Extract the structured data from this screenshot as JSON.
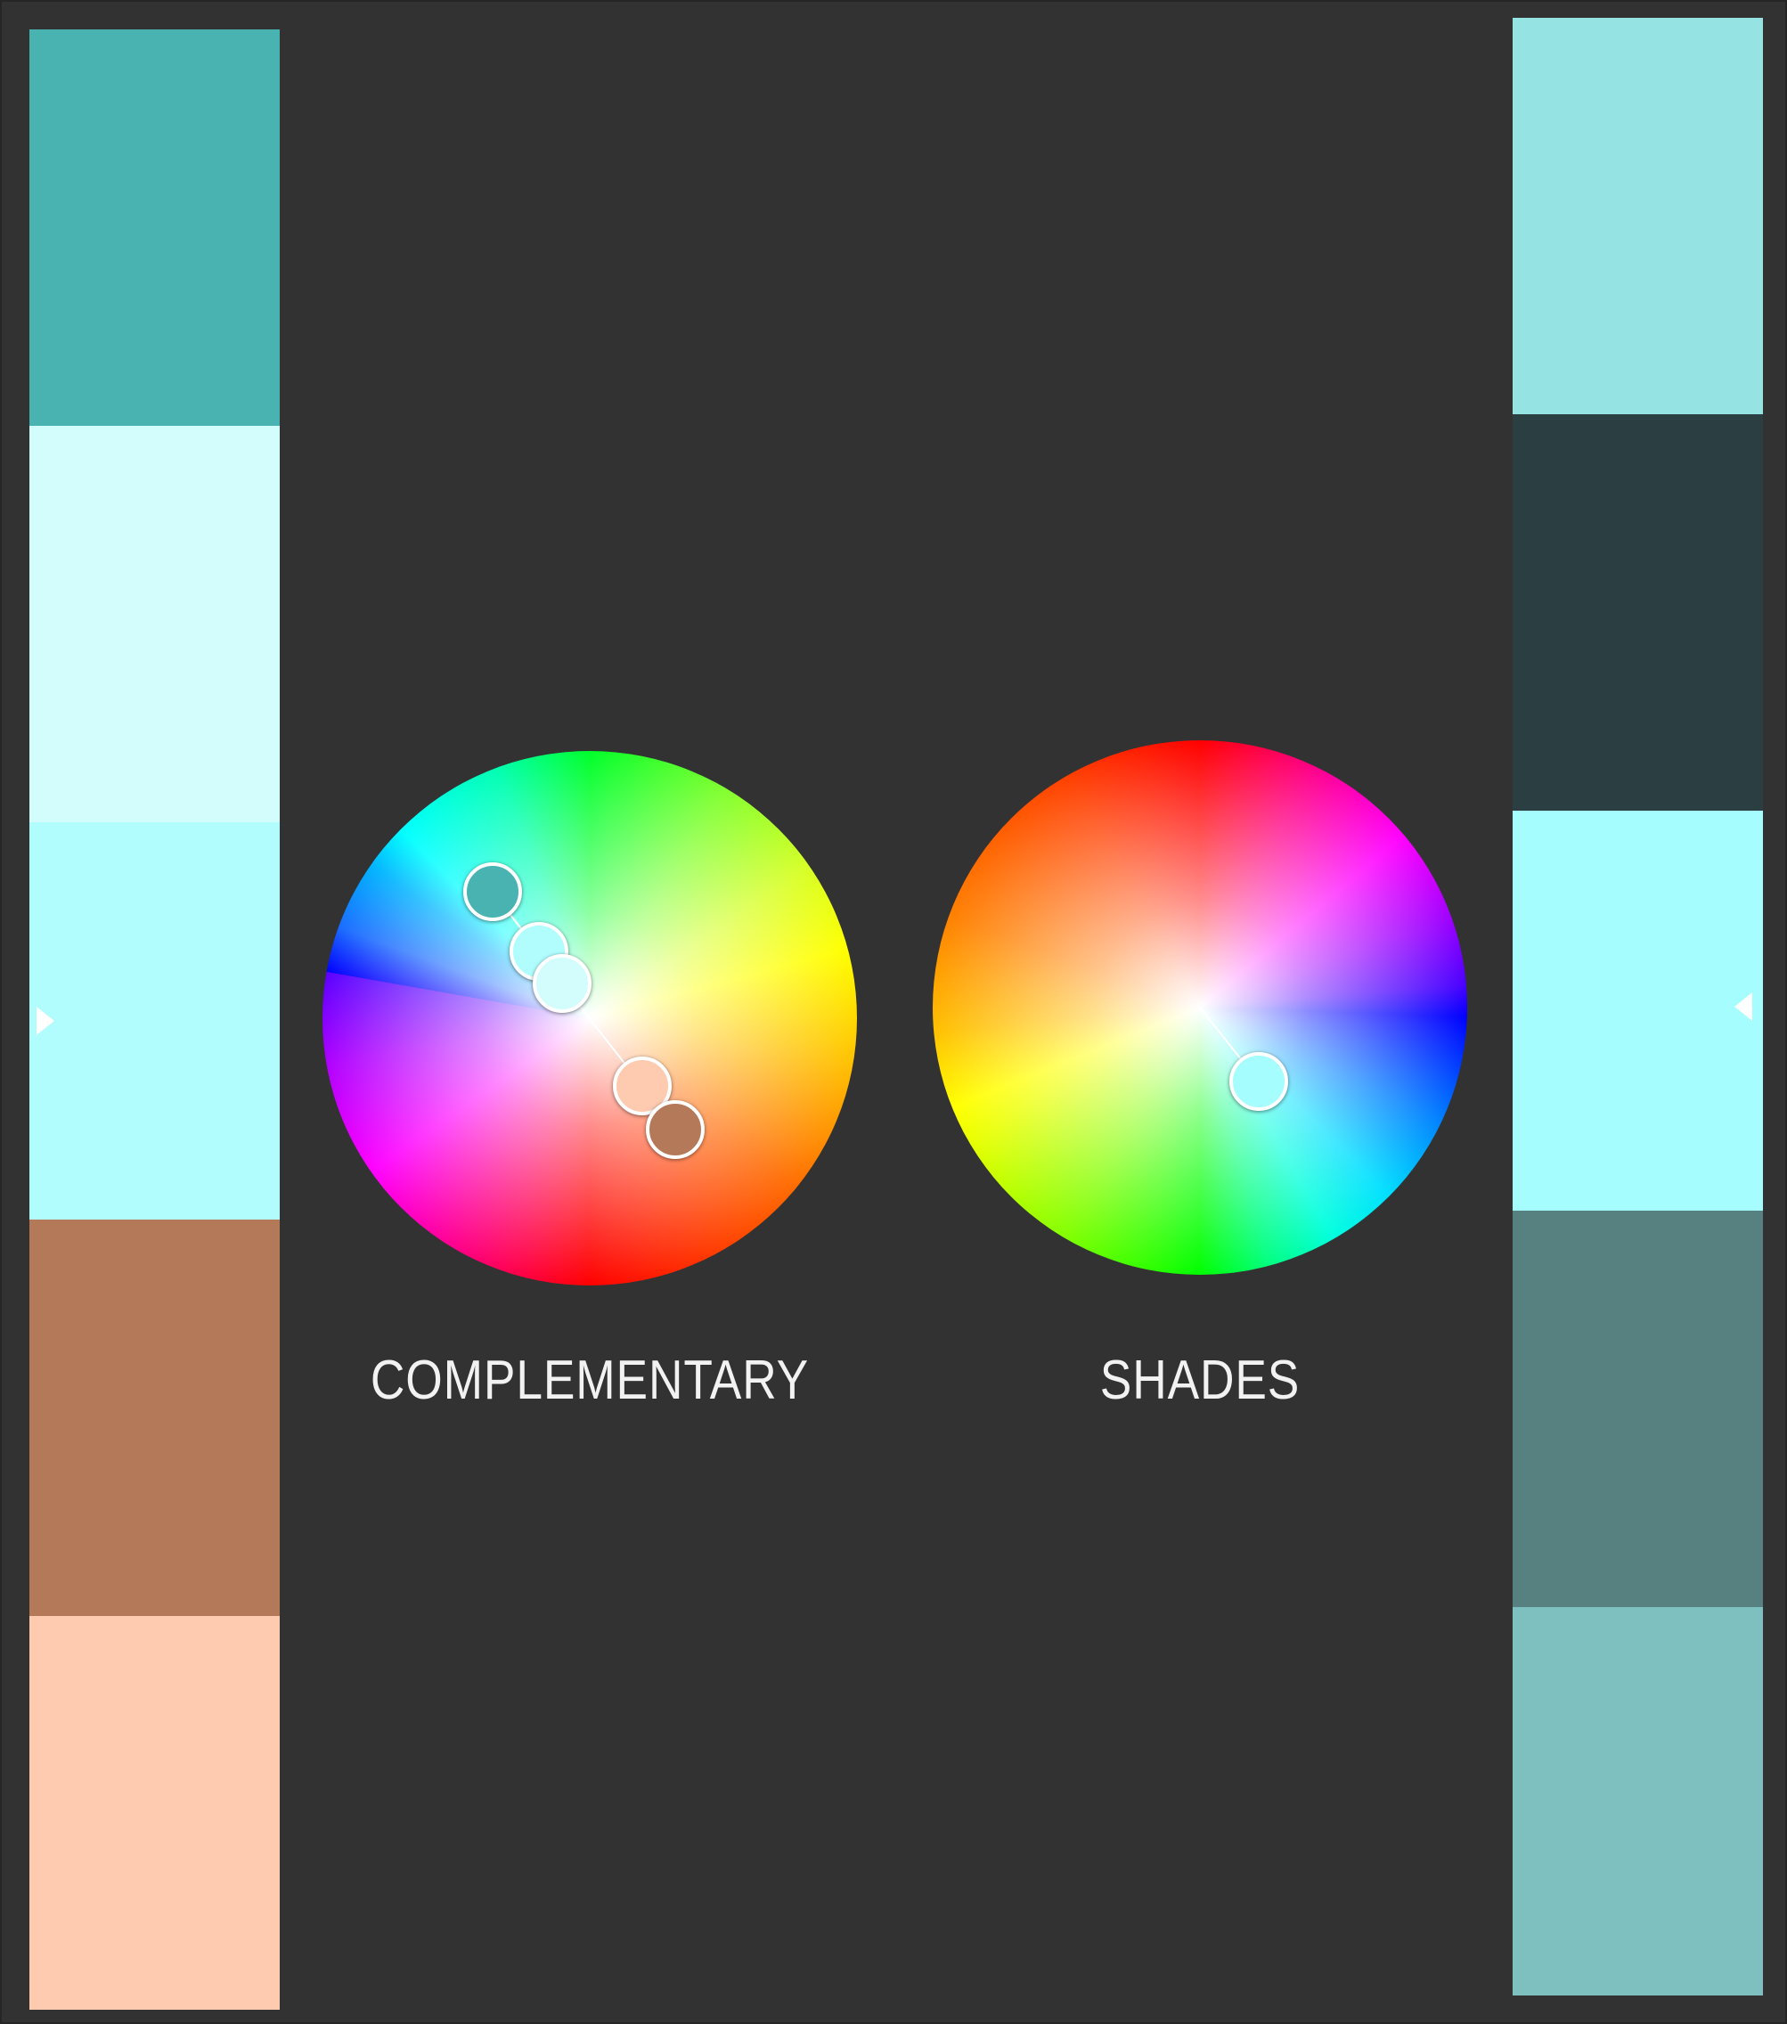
{
  "left_palette": {
    "swatches": [
      {
        "name": "swatch-teal",
        "color": "#48b3b1"
      },
      {
        "name": "swatch-pale-cyan",
        "color": "#d2fdfc"
      },
      {
        "name": "swatch-light-cyan",
        "color": "#b1fdfe"
      },
      {
        "name": "swatch-brown",
        "color": "#b47959"
      },
      {
        "name": "swatch-peach",
        "color": "#ffcbb0"
      }
    ],
    "selected_index": 2
  },
  "right_palette": {
    "swatches": [
      {
        "name": "swatch-light-aqua",
        "color": "#96e3e4"
      },
      {
        "name": "swatch-dark-slate",
        "color": "#2b3e42"
      },
      {
        "name": "swatch-bright-aqua",
        "color": "#a6fdfd"
      },
      {
        "name": "swatch-slate-teal",
        "color": "#568180"
      },
      {
        "name": "swatch-muted-teal",
        "color": "#7ebfc0"
      }
    ],
    "selected_index": 2
  },
  "wheels": {
    "complementary": {
      "label": "COMPLEMENTARY",
      "colors": [
        "#48b3b1",
        "#b1fdfe",
        "#d2fdfc",
        "#ffcbb0",
        "#b47959"
      ]
    },
    "shades": {
      "label": "SHADES",
      "colors": [
        "#a6fdfd"
      ]
    }
  },
  "colors": {
    "background": "#323232",
    "label_text": "#f2f2f2",
    "marker": "#ffffff"
  }
}
